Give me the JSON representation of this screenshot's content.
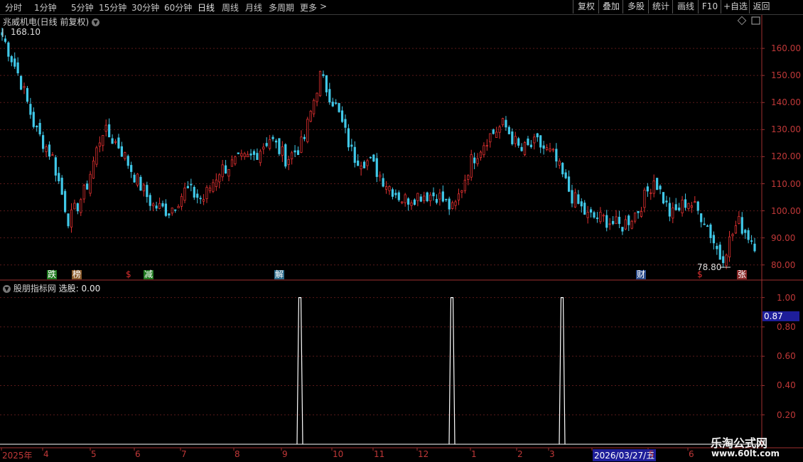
{
  "toolbar": {
    "timeframes": [
      "分时",
      "1分钟",
      "5分钟",
      "15分钟",
      "30分钟",
      "60分钟",
      "日线",
      "周线",
      "月线",
      "多周期",
      "更多"
    ],
    "active_timeframe": "日线",
    "more_arrow": ">",
    "right_buttons": [
      "复权",
      "叠加",
      "多股",
      "统计",
      "画线",
      "F10",
      "+自选",
      "返回"
    ]
  },
  "main_chart": {
    "title": "兆威机电(日线 前复权)",
    "high_label": "168.10",
    "low_label": "78.80",
    "price_axis": [
      "160.00",
      "150.00",
      "140.00",
      "130.00",
      "120.00",
      "110.00",
      "100.00",
      "90.00",
      "80.00"
    ],
    "event_markers": [
      {
        "text": "跌",
        "color": "#ffffff",
        "bg": "#1f7a1f"
      },
      {
        "text": "榜",
        "color": "#ffffff",
        "bg": "#8a5a2a"
      },
      {
        "text": "$",
        "color": "#e03030",
        "bg": ""
      },
      {
        "text": "减",
        "color": "#ffffff",
        "bg": "#1f7a1f"
      },
      {
        "text": "解",
        "color": "#ffffff",
        "bg": "#2a6a8a"
      },
      {
        "text": "财",
        "color": "#ffffff",
        "bg": "#2a4a8a"
      },
      {
        "text": "$",
        "color": "#e03030",
        "bg": ""
      },
      {
        "text": "张",
        "color": "#ffffff",
        "bg": "#8a2a2a"
      }
    ],
    "colors": {
      "up": "#e03030",
      "down": "#40c8e8",
      "axis": "#c03838",
      "grid": "#5a1a1a"
    }
  },
  "indicator": {
    "title": "股朋指标网",
    "label": "选股: 0.00",
    "axis": [
      "1.00",
      "0.80",
      "0.60",
      "0.40",
      "0.20"
    ],
    "current_value": "0.87"
  },
  "date_axis": [
    "2025年",
    "4",
    "5",
    "6",
    "7",
    "8",
    "9",
    "10",
    "11",
    "12",
    "1",
    "2",
    "3",
    "2026/03/27/五",
    "5",
    "6"
  ],
  "watermark": {
    "title": "乐淘公式网",
    "url": "www.60lt.com"
  },
  "chart_data": {
    "type": "candlestick",
    "title": "兆威机电(日线 前复权)",
    "ylim": [
      76,
      170
    ],
    "high": 168.1,
    "low": 78.8,
    "close_path": [
      {
        "x": "2025-03",
        "y": 165
      },
      {
        "x": "2025-03",
        "y": 150
      },
      {
        "x": "2025-03",
        "y": 130
      },
      {
        "x": "2025-03",
        "y": 120
      },
      {
        "x": "2025-04",
        "y": 96
      },
      {
        "x": "2025-04",
        "y": 108
      },
      {
        "x": "2025-04",
        "y": 130
      },
      {
        "x": "2025-05",
        "y": 124
      },
      {
        "x": "2025-05",
        "y": 112
      },
      {
        "x": "2025-06",
        "y": 102
      },
      {
        "x": "2025-06",
        "y": 100
      },
      {
        "x": "2025-06",
        "y": 108
      },
      {
        "x": "2025-07",
        "y": 104
      },
      {
        "x": "2025-07",
        "y": 115
      },
      {
        "x": "2025-07",
        "y": 118
      },
      {
        "x": "2025-08",
        "y": 120
      },
      {
        "x": "2025-08",
        "y": 127
      },
      {
        "x": "2025-08",
        "y": 119
      },
      {
        "x": "2025-09",
        "y": 125
      },
      {
        "x": "2025-09",
        "y": 150
      },
      {
        "x": "2025-09",
        "y": 138
      },
      {
        "x": "2025-10",
        "y": 120
      },
      {
        "x": "2025-10",
        "y": 118
      },
      {
        "x": "2025-10",
        "y": 110
      },
      {
        "x": "2025-11",
        "y": 104
      },
      {
        "x": "2025-11",
        "y": 106
      },
      {
        "x": "2025-12",
        "y": 106
      },
      {
        "x": "2025-12",
        "y": 100
      },
      {
        "x": "2025-12",
        "y": 118
      },
      {
        "x": "2026-01",
        "y": 127
      },
      {
        "x": "2026-01",
        "y": 132
      },
      {
        "x": "2026-01",
        "y": 122
      },
      {
        "x": "2026-02",
        "y": 125
      },
      {
        "x": "2026-02",
        "y": 120
      },
      {
        "x": "2026-02",
        "y": 106
      },
      {
        "x": "2026-03",
        "y": 98
      },
      {
        "x": "2026-03",
        "y": 97
      },
      {
        "x": "2026-03",
        "y": 94
      },
      {
        "x": "2026-03",
        "y": 100
      },
      {
        "x": "2026-04",
        "y": 112
      },
      {
        "x": "2026-04",
        "y": 98
      },
      {
        "x": "2026-04",
        "y": 104
      },
      {
        "x": "2026-05",
        "y": 97
      },
      {
        "x": "2026-05",
        "y": 82
      },
      {
        "x": "2026-05",
        "y": 96
      },
      {
        "x": "2026-06",
        "y": 88
      }
    ],
    "signal_series": {
      "name": "选股",
      "ylim": [
        0,
        1.1
      ],
      "spikes": [
        {
          "x": "2025-09",
          "value": 1.0
        },
        {
          "x": "2026-01",
          "value": 1.0
        },
        {
          "x": "2026-03",
          "value": 1.0
        }
      ]
    }
  }
}
